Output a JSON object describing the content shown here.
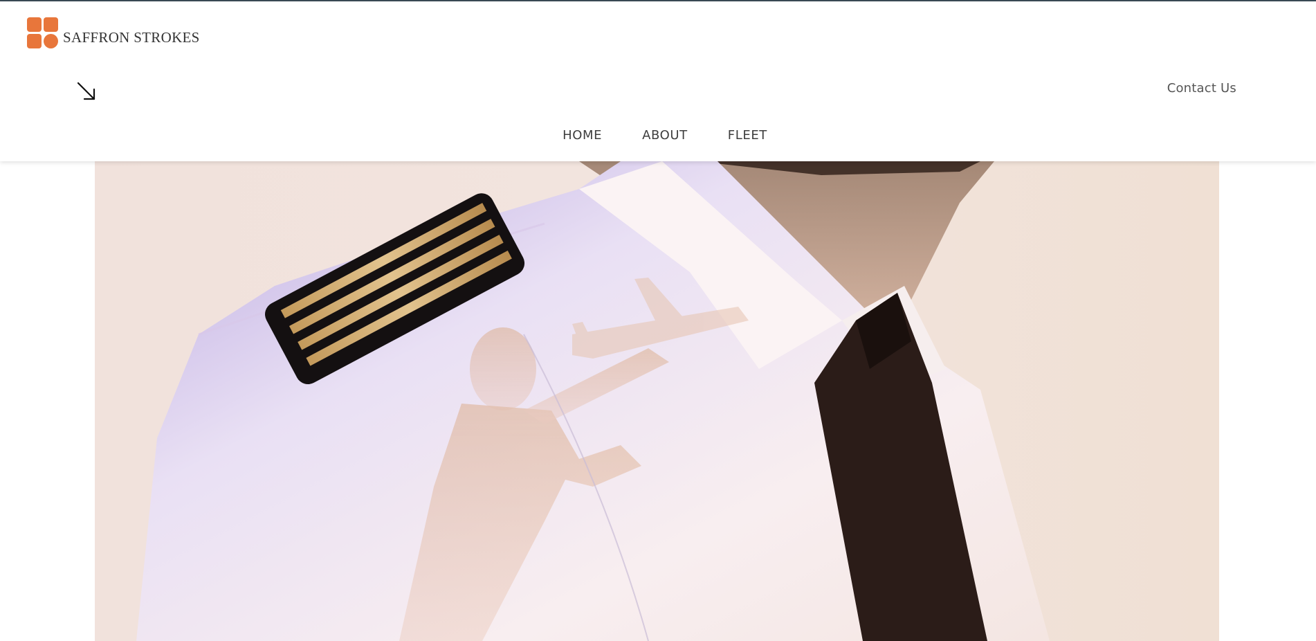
{
  "brand": {
    "name": "SAFFRON STROKES",
    "accent_color": "#e8763b"
  },
  "header": {
    "menu_toggle_icon": "arrow-down-right-icon",
    "contact_label": "Contact Us"
  },
  "nav": {
    "items": [
      {
        "label": "HOME"
      },
      {
        "label": "ABOUT"
      },
      {
        "label": "FLEET"
      }
    ]
  },
  "hero": {
    "image_alt": "pilot-uniform-double-exposure"
  }
}
